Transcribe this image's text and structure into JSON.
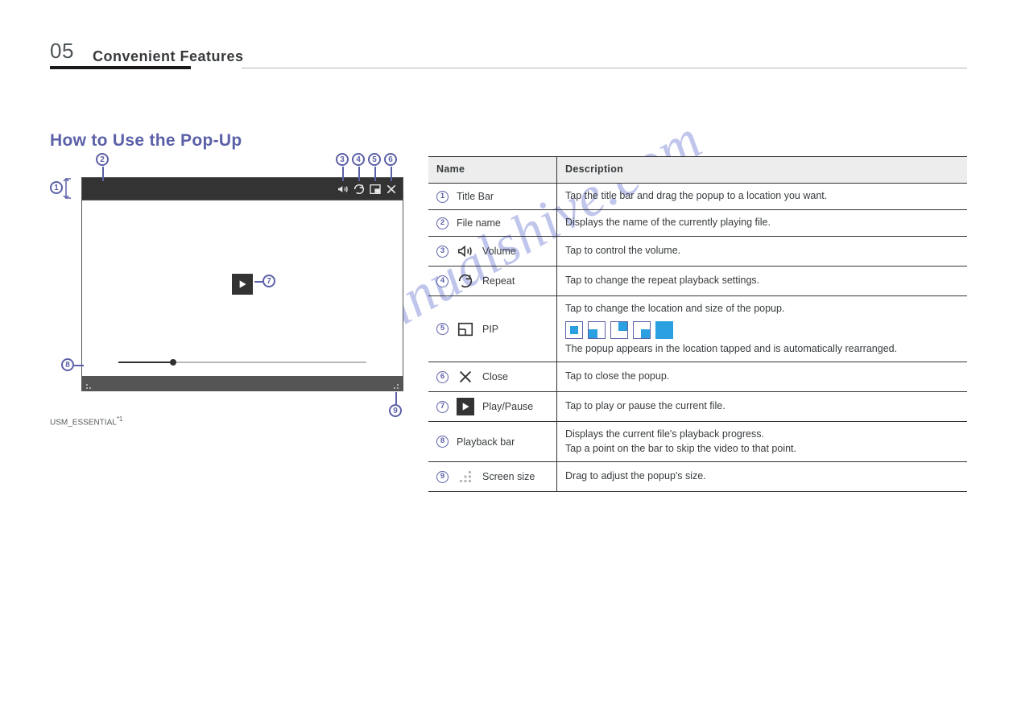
{
  "page_number": "05",
  "section_title": "Convenient Features",
  "subheading": "How to Use the Pop-Up",
  "footnote": "USM_ESSENTIAL",
  "watermark": "manualshive.com",
  "table": {
    "header": {
      "c1": "Name",
      "c2": "Description"
    },
    "rows": [
      {
        "n": "1",
        "label": "Title Bar",
        "desc": "Tap the title bar and drag the popup to a location you want."
      },
      {
        "n": "2",
        "label": "File name",
        "desc": "Displays the name of the currently playing file."
      },
      {
        "n": "3",
        "label": "Volume",
        "desc": "Tap to control the volume."
      },
      {
        "n": "4",
        "label": "Repeat",
        "desc": "Tap to change the repeat playback settings."
      },
      {
        "n": "5",
        "label": "PIP",
        "desc": "Tap to change the location and size of the popup.",
        "note": "The popup appears in the location tapped and is automatically rearranged.",
        "pipicons": true
      },
      {
        "n": "6",
        "label": "Close",
        "desc": "Tap to close the popup."
      },
      {
        "n": "7",
        "label": "Play/Pause",
        "desc": "Tap to play or pause the current file."
      },
      {
        "n": "8",
        "label": "Playback bar",
        "desc": "Displays the current file's playback progress.",
        "note": "Tap a point on the bar to skip the video to that point."
      },
      {
        "n": "9",
        "label": "Screen size",
        "desc": "Drag to adjust the popup's size."
      }
    ]
  }
}
